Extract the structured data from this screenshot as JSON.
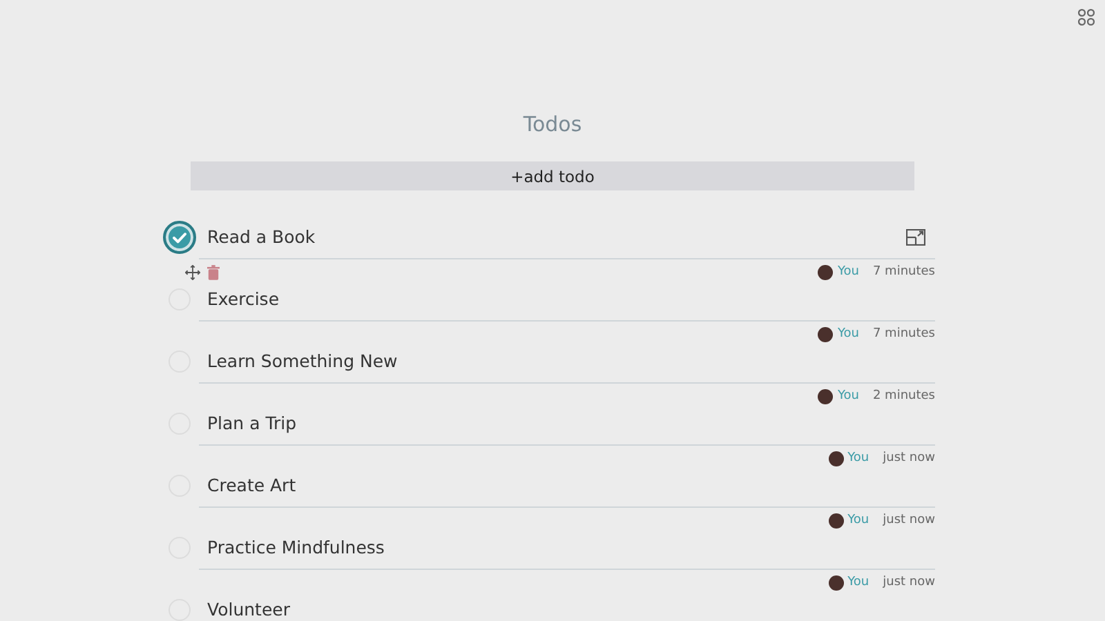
{
  "title": "Todos",
  "add_button": "+add todo",
  "todos": [
    {
      "text": "Read a Book",
      "checked": true,
      "show_actions": true,
      "author": "You",
      "time": "7 minutes"
    },
    {
      "text": "Exercise",
      "checked": false,
      "show_actions": false,
      "author": "You",
      "time": "7 minutes"
    },
    {
      "text": "Learn Something New",
      "checked": false,
      "show_actions": false,
      "author": "You",
      "time": "2 minutes"
    },
    {
      "text": "Plan a Trip",
      "checked": false,
      "show_actions": false,
      "author": "You",
      "time": "just now"
    },
    {
      "text": "Create Art",
      "checked": false,
      "show_actions": false,
      "author": "You",
      "time": "just now"
    },
    {
      "text": "Practice Mindfulness",
      "checked": false,
      "show_actions": false,
      "author": "You",
      "time": "just now"
    },
    {
      "text": "Volunteer",
      "checked": false,
      "show_actions": false
    }
  ]
}
